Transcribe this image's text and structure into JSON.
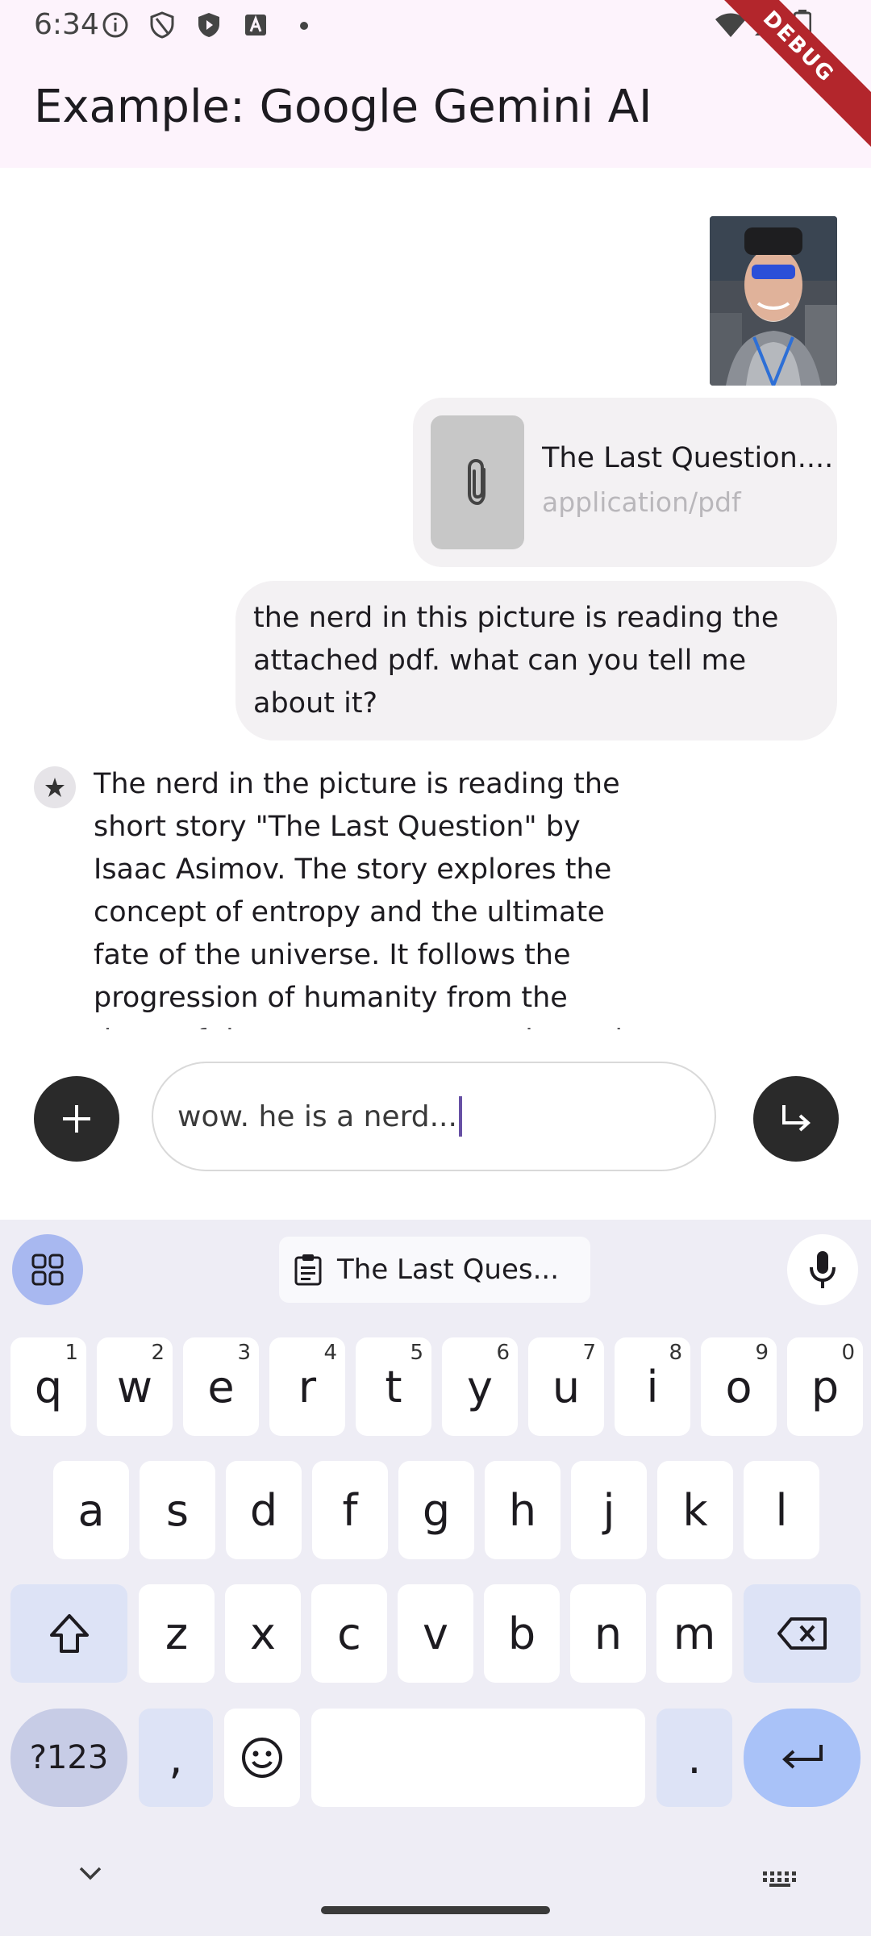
{
  "status_bar": {
    "time": "6:34"
  },
  "app_bar": {
    "title": "Example: Google Gemini AI",
    "debug_label": "DEBUG"
  },
  "chat": {
    "attachment": {
      "file_name": "The Last Question....",
      "mime_type": "application/pdf"
    },
    "user_message": "the nerd in this picture is reading the attached pdf. what can you tell me about it?",
    "ai_message": "The nerd in the picture is reading the short story \"The Last Question\" by Isaac Asimov. The story explores the concept of entropy and the ultimate fate of the universe. It follows the progression of humanity from the dawn of the computer age to the end of the universe"
  },
  "input": {
    "value": "wow. he is a nerd..."
  },
  "keyboard": {
    "clipboard_suggestion": "The Last Ques...",
    "row1": [
      {
        "k": "q",
        "h": "1"
      },
      {
        "k": "w",
        "h": "2"
      },
      {
        "k": "e",
        "h": "3"
      },
      {
        "k": "r",
        "h": "4"
      },
      {
        "k": "t",
        "h": "5"
      },
      {
        "k": "y",
        "h": "6"
      },
      {
        "k": "u",
        "h": "7"
      },
      {
        "k": "i",
        "h": "8"
      },
      {
        "k": "o",
        "h": "9"
      },
      {
        "k": "p",
        "h": "0"
      }
    ],
    "row2": [
      "a",
      "s",
      "d",
      "f",
      "g",
      "h",
      "j",
      "k",
      "l"
    ],
    "row3": [
      "z",
      "x",
      "c",
      "v",
      "b",
      "n",
      "m"
    ],
    "symbols_label": "?123",
    "comma": ",",
    "period": "."
  },
  "colors": {
    "accent": "#6750a4",
    "app_bar_bg": "#fdf3fc",
    "keyboard_bg": "#eeedf5",
    "debug_ribbon": "#b3262c"
  }
}
